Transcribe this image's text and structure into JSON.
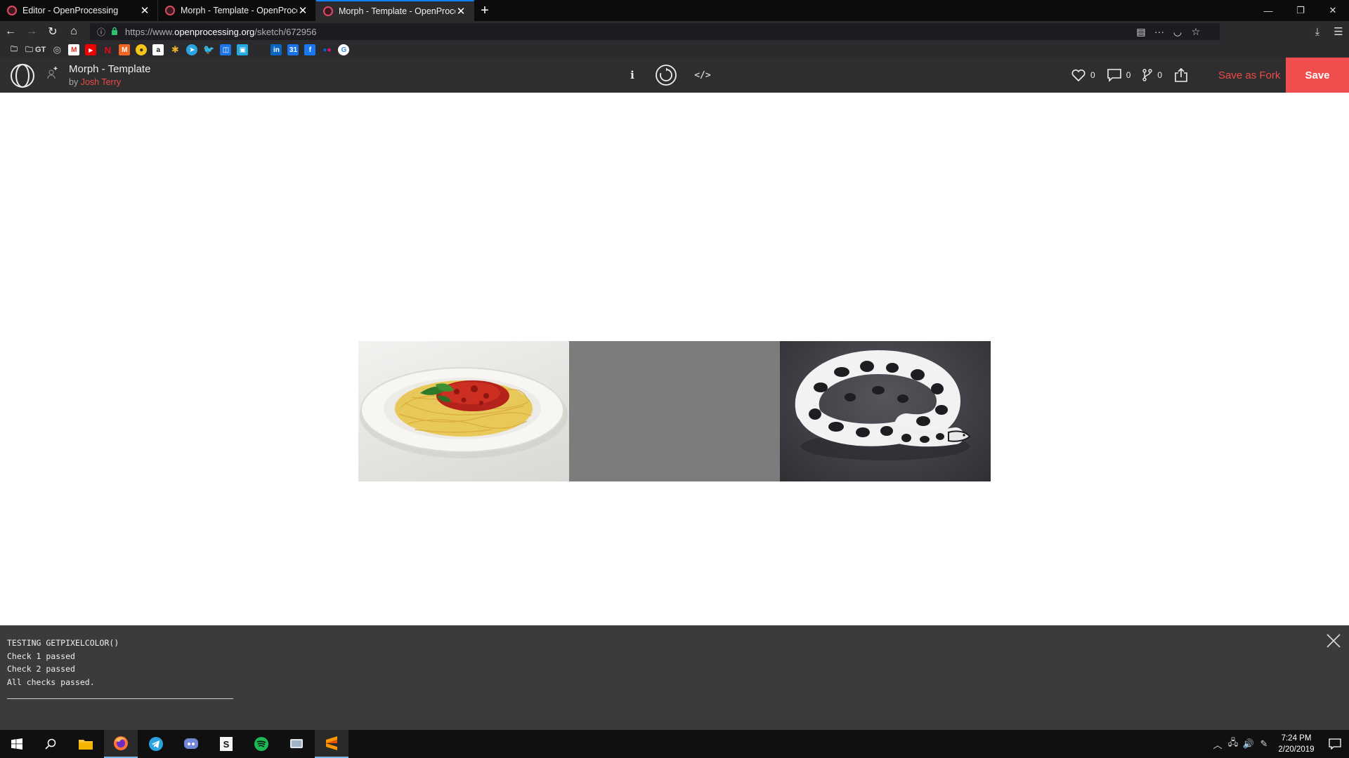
{
  "browser": {
    "tabs": [
      {
        "title": "Editor - OpenProcessing",
        "active": false
      },
      {
        "title": "Morph - Template - OpenProcessing",
        "active": false
      },
      {
        "title": "Morph - Template - OpenProcessing",
        "active": true
      }
    ],
    "new_tab": "+",
    "url_prefix": "https://www.",
    "url_host": "openprocessing.org",
    "url_path": "/sketch/672956",
    "bookmarks": [
      "GT"
    ]
  },
  "header": {
    "sketch_title": "Morph - Template",
    "by_label": "by",
    "author": "Josh Terry",
    "info_label": "i",
    "code_label": "</>",
    "likes": "0",
    "comments": "0",
    "forks": "0",
    "save_fork_label": "Save as Fork",
    "save_label": "Save",
    "accent": "#f04e4e"
  },
  "console": {
    "lines": [
      "TESTING GETPIXELCOLOR()",
      "Check 1 passed",
      "Check 2 passed",
      "All checks passed."
    ]
  },
  "taskbar": {
    "time": "7:24 PM",
    "date": "2/20/2019"
  }
}
